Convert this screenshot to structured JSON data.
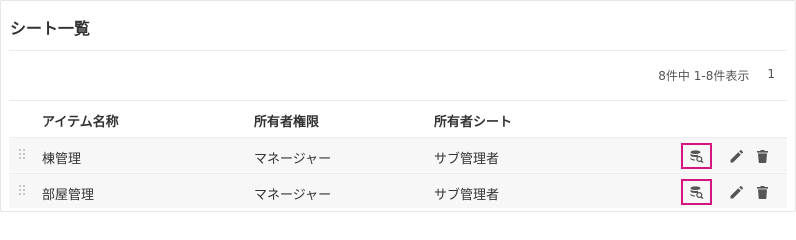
{
  "page": {
    "title": "シート一覧"
  },
  "pagination": {
    "summary": "8件中 1-8件表示",
    "page": "1"
  },
  "table": {
    "columns": [
      "アイテム名称",
      "所有者権限",
      "所有者シート"
    ],
    "rows": [
      {
        "name": "棟管理",
        "permission": "マネージャー",
        "owner_sheet": "サブ管理者"
      },
      {
        "name": "部屋管理",
        "permission": "マネージャー",
        "owner_sheet": "サブ管理者"
      }
    ]
  },
  "colors": {
    "highlight": "#d4147f",
    "icon": "#555555",
    "row_bg": "#f7f7f7"
  },
  "icons": {
    "drag": "drag-handle-icon",
    "view": "database-search-icon",
    "edit": "pencil-icon",
    "delete": "trash-icon"
  }
}
